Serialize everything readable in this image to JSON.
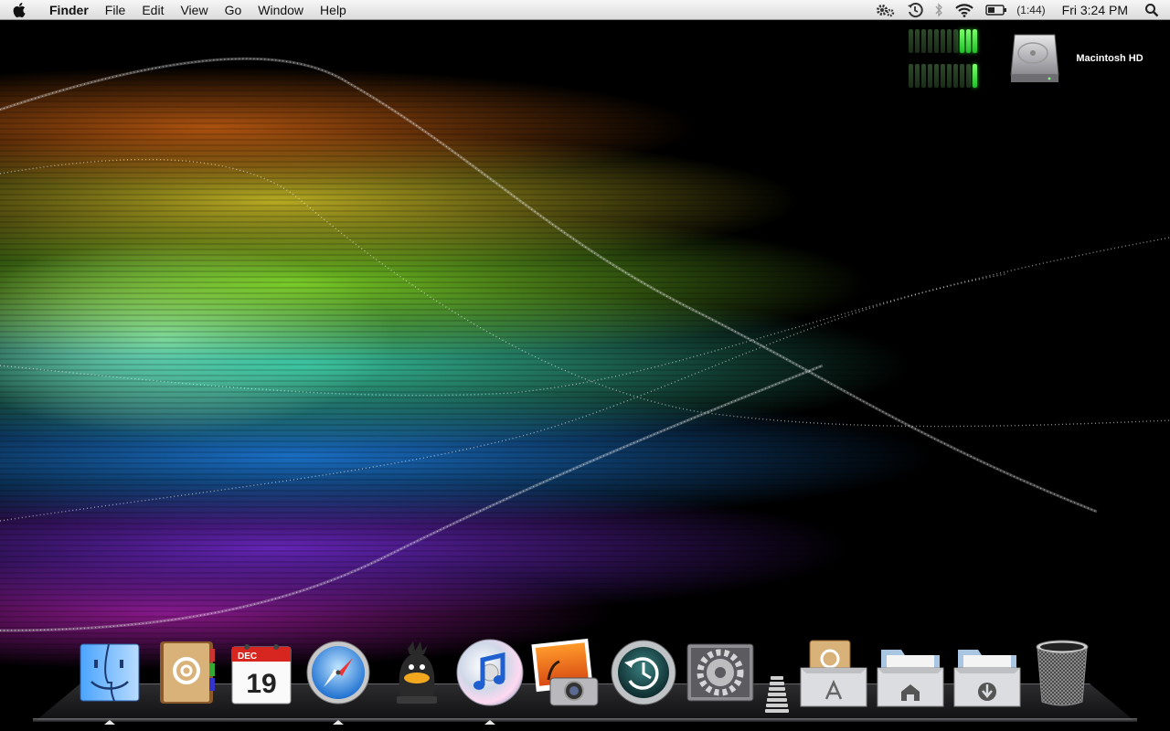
{
  "menubar": {
    "apple_icon": "apple-icon",
    "app_name": "Finder",
    "menus": [
      "File",
      "Edit",
      "View",
      "Go",
      "Window",
      "Help"
    ],
    "battery_time": "(1:44)",
    "clock": "Fri 3:24 PM",
    "extras": [
      "gears-icon",
      "time-machine-icon",
      "bluetooth-icon",
      "wifi-icon",
      "battery-icon",
      "spotlight-icon"
    ]
  },
  "desktop": {
    "hd_label": "Macintosh HD",
    "meter_levels": {
      "top": 0.27,
      "bottom": 0.09
    }
  },
  "dock": {
    "apps": [
      "finder",
      "address-book",
      "ical",
      "safari",
      "adium",
      "itunes",
      "iphoto",
      "time-machine",
      "system-preferences"
    ],
    "ical": {
      "month": "DEC",
      "day": "19"
    },
    "running": [
      "finder",
      "safari",
      "itunes"
    ],
    "stacks": [
      "applications",
      "home",
      "downloads"
    ],
    "trash": "trash"
  }
}
